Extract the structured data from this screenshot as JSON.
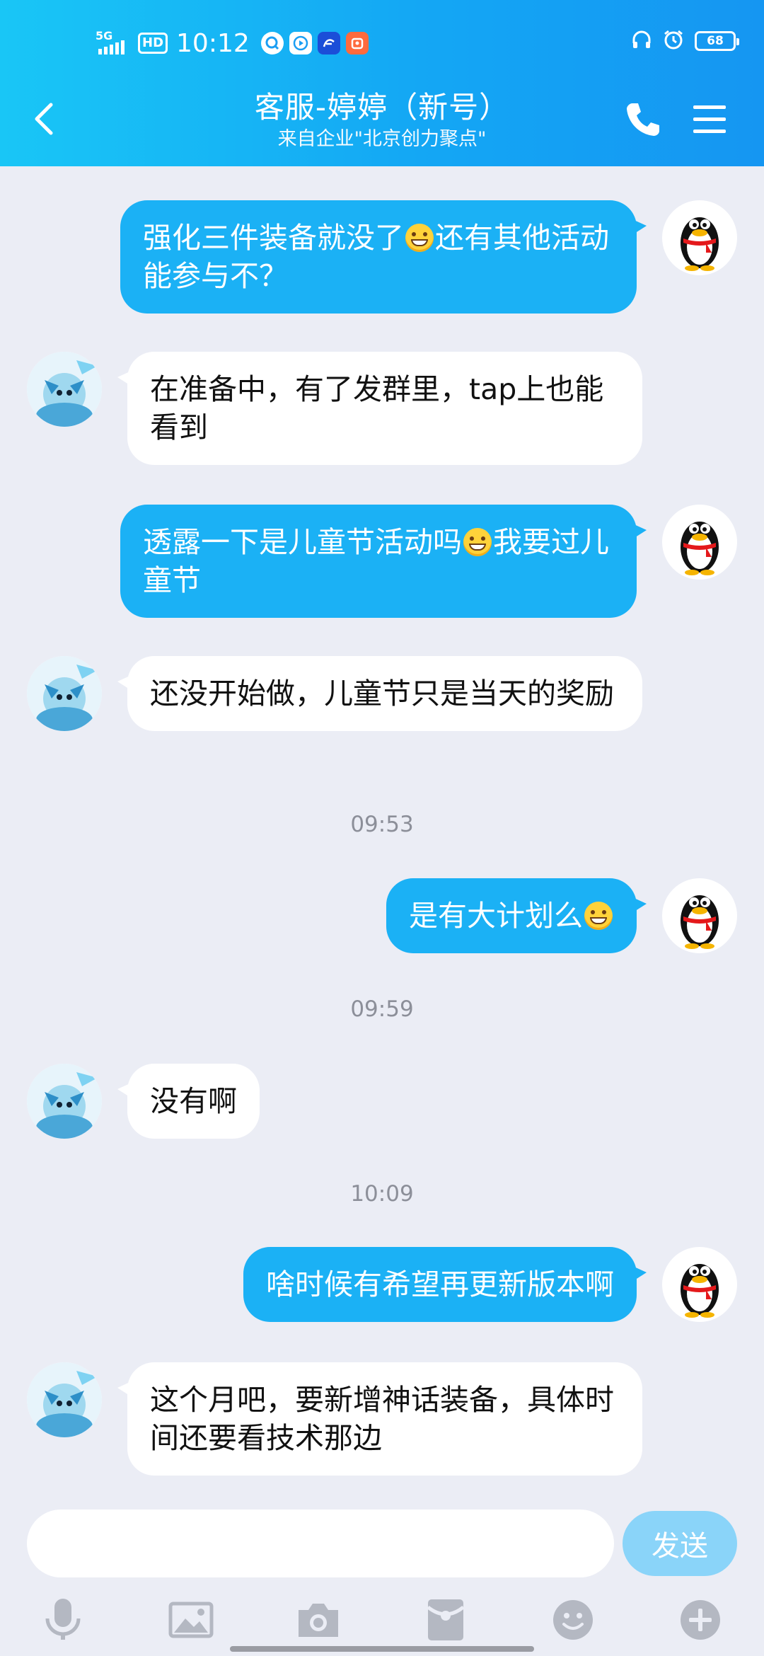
{
  "status_bar": {
    "network": "5G",
    "hd": "HD",
    "time": "10:12",
    "battery": "68"
  },
  "header": {
    "title": "客服-婷婷（新号）",
    "subtitle": "来自企业\"北京创力聚点\""
  },
  "messages": [
    {
      "dir": "out",
      "parts": [
        "强化三件装备就没了",
        "还有其他活动能参与不？"
      ]
    },
    {
      "dir": "in",
      "text": "在准备中，有了发群里，tap上也能看到"
    },
    {
      "dir": "out",
      "parts": [
        "透露一下是儿童节活动吗",
        "我要过儿童节"
      ]
    },
    {
      "dir": "in",
      "text": "还没开始做，儿童节只是当天的奖励"
    },
    {
      "dir": "out",
      "parts": [
        "是有大计划么",
        ""
      ]
    },
    {
      "dir": "in",
      "text": "没有啊"
    },
    {
      "dir": "out",
      "text": "啥时候有希望再更新版本啊"
    },
    {
      "dir": "in",
      "text": "这个月吧，要新增神话装备，具体时间还要看技术那边"
    }
  ],
  "timestamps": [
    "09:53",
    "09:59",
    "10:09"
  ],
  "input": {
    "value": "",
    "placeholder": "",
    "send_label": "发送"
  },
  "colors": {
    "header_start": "#19c6f6",
    "header_end": "#1596f2",
    "outgoing_bubble": "#1bb1f5",
    "incoming_bubble": "#ffffff",
    "background": "#ebedf5",
    "send_button": "#8ad4f9"
  },
  "toolbar_icons": [
    "microphone-icon",
    "image-icon",
    "camera-icon",
    "red-packet-icon",
    "emoji-icon",
    "plus-icon"
  ]
}
